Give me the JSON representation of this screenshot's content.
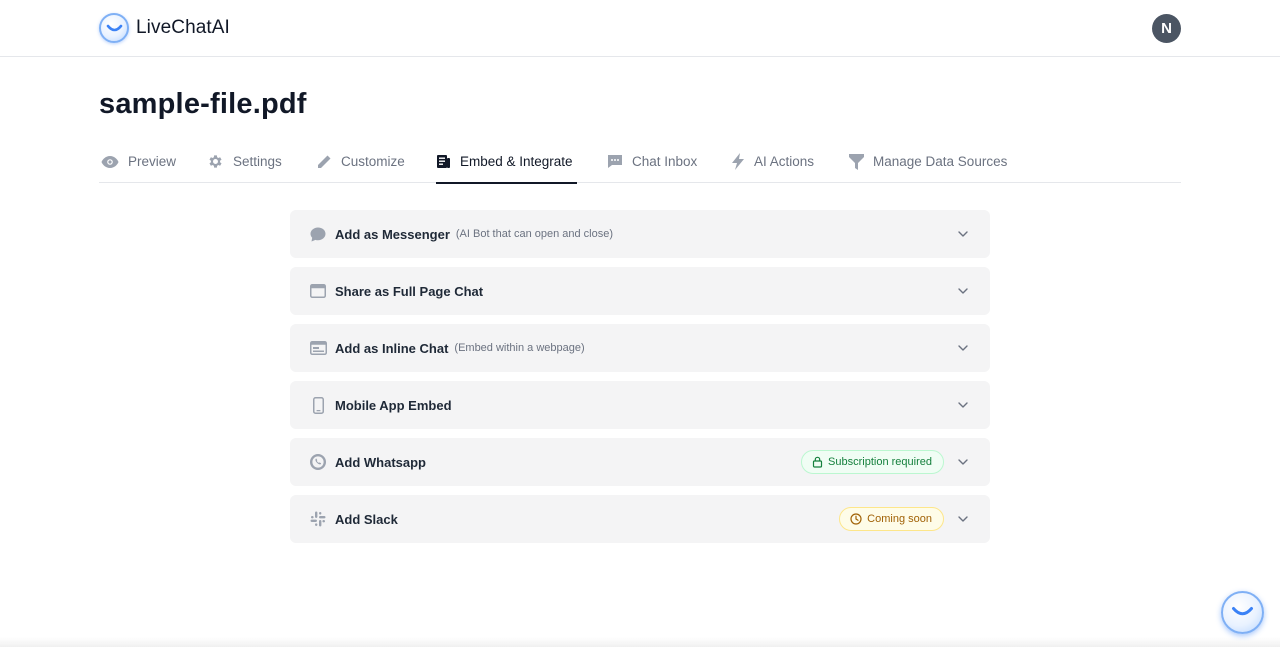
{
  "brand": {
    "name": "LiveChatAI"
  },
  "user": {
    "avatar_initial": "N"
  },
  "page": {
    "title": "sample-file.pdf"
  },
  "tabs": [
    {
      "label": "Preview",
      "icon": "eye-icon",
      "active": false
    },
    {
      "label": "Settings",
      "icon": "gear-icon",
      "active": false
    },
    {
      "label": "Customize",
      "icon": "pencil-icon",
      "active": false
    },
    {
      "label": "Embed & Integrate",
      "icon": "document-icon",
      "active": true
    },
    {
      "label": "Chat Inbox",
      "icon": "chat-bubble-icon",
      "active": false
    },
    {
      "label": "AI Actions",
      "icon": "lightning-icon",
      "active": false
    },
    {
      "label": "Manage Data Sources",
      "icon": "funnel-icon",
      "active": false
    }
  ],
  "integrations": [
    {
      "title": "Add as Messenger",
      "subtitle": "(AI Bot that can open and close)",
      "icon": "speech-bubble-icon"
    },
    {
      "title": "Share as Full Page Chat",
      "subtitle": "",
      "icon": "browser-window-icon"
    },
    {
      "title": "Add as Inline Chat",
      "subtitle": "(Embed within a webpage)",
      "icon": "inline-window-icon"
    },
    {
      "title": "Mobile App Embed",
      "subtitle": "",
      "icon": "mobile-phone-icon"
    },
    {
      "title": "Add Whatsapp",
      "subtitle": "",
      "icon": "whatsapp-icon",
      "badge": {
        "text": "Subscription required",
        "icon": "lock-icon",
        "color": "#15803d"
      }
    },
    {
      "title": "Add Slack",
      "subtitle": "",
      "icon": "slack-icon",
      "badge": {
        "text": "Coming soon",
        "icon": "clock-icon",
        "color": "#a16207"
      }
    }
  ],
  "colors": {
    "accent": "#111827",
    "panel_bg": "#f4f4f5",
    "brand_blue": "#7fb0f5"
  }
}
